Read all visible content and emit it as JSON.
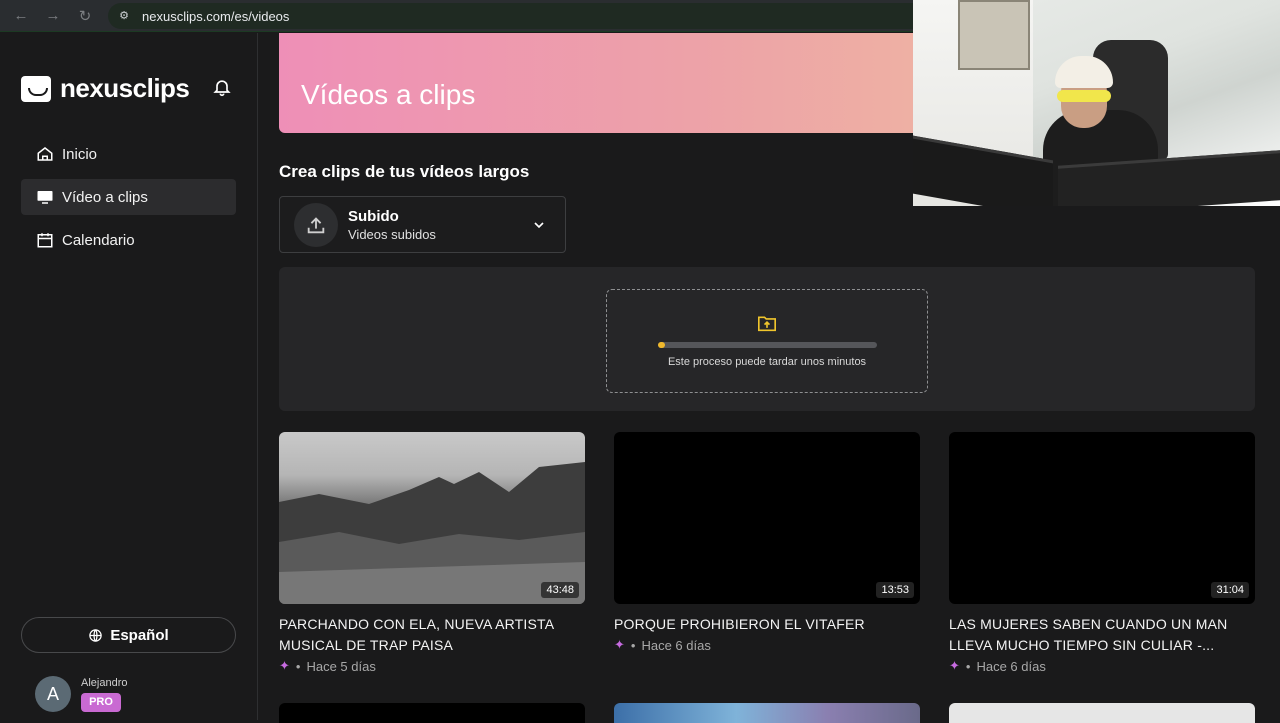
{
  "browser": {
    "url": "nexusclips.com/es/videos"
  },
  "sidebar": {
    "logo_text": "nexusclips",
    "items": [
      {
        "label": "Inicio",
        "icon": "home-icon",
        "active": false
      },
      {
        "label": "Vídeo a clips",
        "icon": "monitor-icon",
        "active": true
      },
      {
        "label": "Calendario",
        "icon": "calendar-icon",
        "active": false
      }
    ],
    "language": "Español",
    "user": {
      "initial": "A",
      "name": "Alejandro",
      "badge": "PRO"
    }
  },
  "banner": {
    "title": "Vídeos a clips"
  },
  "main": {
    "section_title": "Crea clips de tus vídeos largos",
    "source_selector": {
      "title": "Subido",
      "subtitle": "Videos subidos"
    },
    "upload": {
      "message": "Este proceso puede tardar unos minutos",
      "progress": 0.03
    }
  },
  "videos": [
    {
      "title": "PARCHANDO CON ELA, NUEVA ARTISTA MUSICAL DE TRAP PAISA",
      "duration": "43:48",
      "age": "Hace 5 días"
    },
    {
      "title": "PORQUE PROHIBIERON EL VITAFER",
      "duration": "13:53",
      "age": "Hace 6 días"
    },
    {
      "title": "LAS MUJERES SABEN CUANDO UN MAN LLEVA MUCHO TIEMPO SIN CULIAR -...",
      "duration": "31:04",
      "age": "Hace 6 días"
    }
  ],
  "colors": {
    "accent_pink": "#ee8fb7",
    "accent_peach": "#efc79d",
    "progress_yellow": "#f0b82c",
    "pro_badge": "#c96ad2"
  }
}
